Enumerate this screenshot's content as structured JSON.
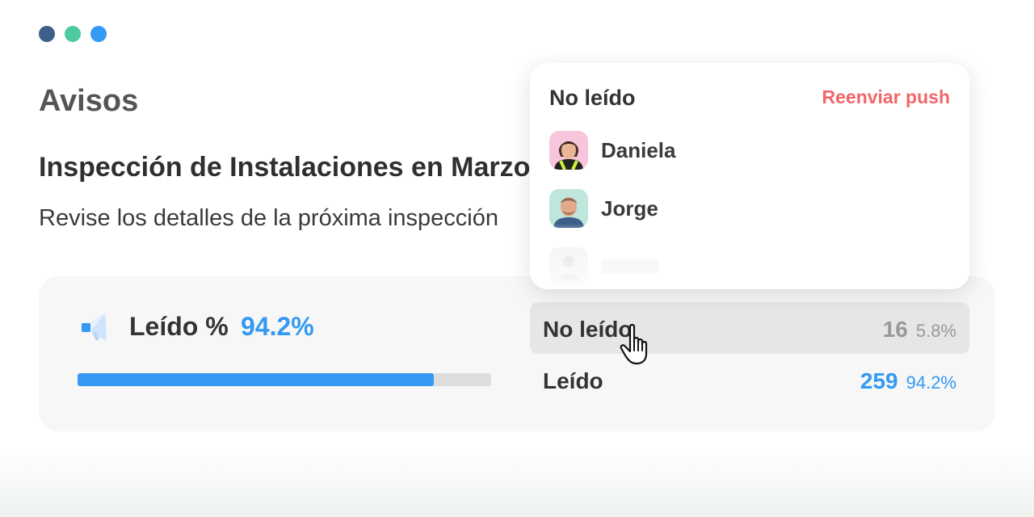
{
  "window": {
    "dot_colors": [
      "#3d5f8a",
      "#4ecaa3",
      "#3399f3"
    ]
  },
  "page": {
    "title": "Avisos"
  },
  "notice": {
    "title": "Inspección de Instalaciones en Marzo",
    "description": "Revise los detalles de la próxima inspección"
  },
  "stats": {
    "read_label": "Leído %",
    "read_percent": "94.2%",
    "read_fraction": 0.862,
    "icon": "megaphone-icon",
    "rows": [
      {
        "label": "No leído",
        "count": "16",
        "percent": "5.8%"
      },
      {
        "label": "Leído",
        "count": "259",
        "percent": "94.2%"
      }
    ]
  },
  "popover": {
    "title": "No leído",
    "action_label": "Reenviar push",
    "users": [
      {
        "name": "Daniela"
      },
      {
        "name": "Jorge"
      }
    ]
  },
  "colors": {
    "accent": "#3399f3",
    "danger": "#f2666a"
  }
}
